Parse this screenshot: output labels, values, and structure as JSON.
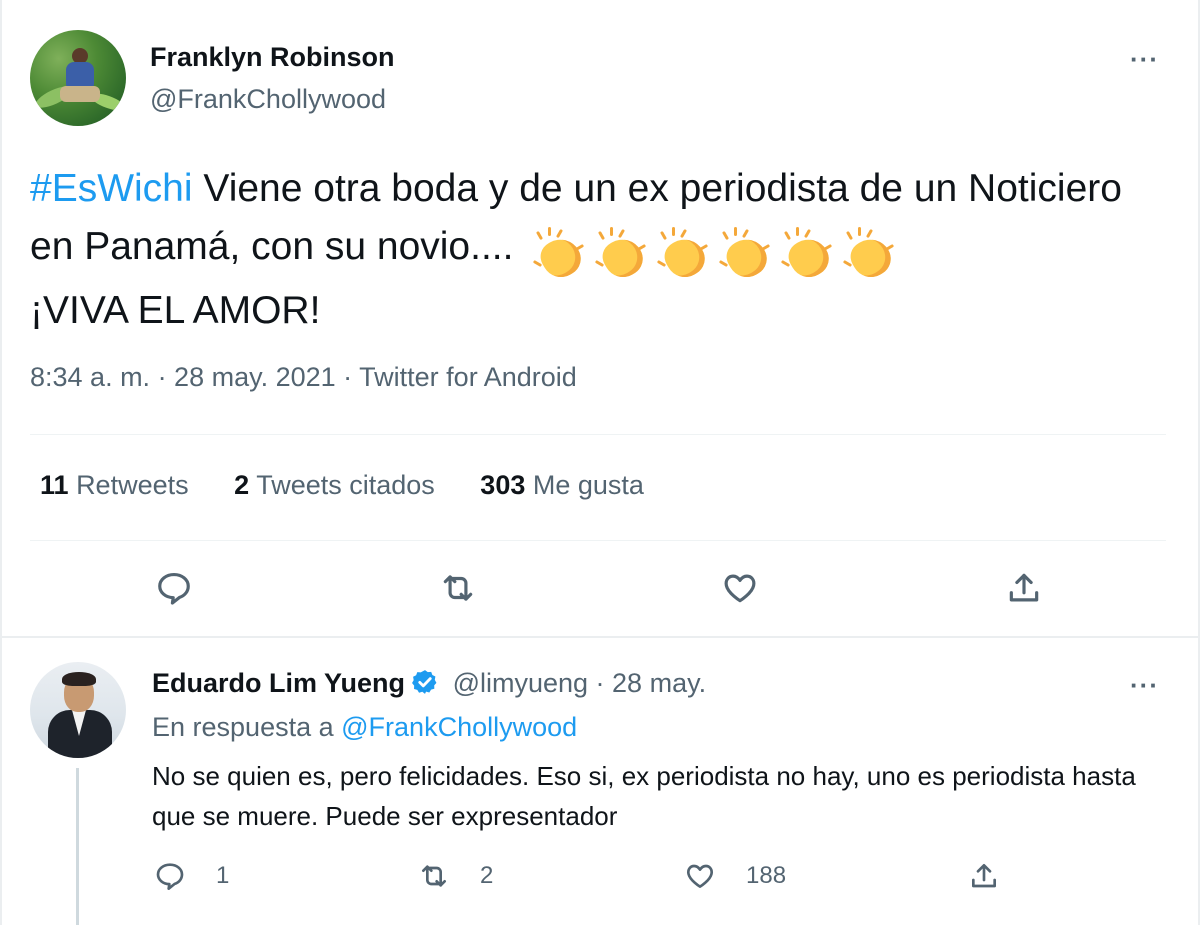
{
  "main_tweet": {
    "author_name": "Franklyn Robinson",
    "author_handle": "@FrankChollywood",
    "more_label": "···",
    "hashtag": "#EsWichi",
    "text_part1": " Viene otra boda y de un ex periodista de un Noticiero en Panamá, con su novio.... ",
    "emoji": "clapping-hands",
    "emoji_count": 6,
    "text_part2": "¡VIVA EL AMOR!",
    "timestamp": "8:34 a. m. · 28 may. 2021 · Twitter for Android",
    "stats": {
      "retweets_count": "11",
      "retweets_label": "Retweets",
      "quotes_count": "2",
      "quotes_label": "Tweets citados",
      "likes_count": "303",
      "likes_label": "Me gusta"
    },
    "actions": [
      "reply-icon",
      "retweet-icon",
      "like-icon",
      "share-icon"
    ]
  },
  "reply_tweet": {
    "author_name": "Eduardo Lim Yueng",
    "verified": true,
    "author_handle": "@limyueng",
    "date": "· 28 may.",
    "more_label": "···",
    "in_reply_prefix": "En respuesta a",
    "in_reply_handle": "@FrankChollywood",
    "text": "No se quien es, pero felicidades. Eso si, ex periodista no hay, uno es periodista hasta que se muere. Puede ser expresentador",
    "reply_count": "1",
    "retweet_count": "2",
    "like_count": "188"
  },
  "colors": {
    "accent": "#1d9bf0",
    "text_primary": "#0f1419",
    "text_secondary": "#536471",
    "divider": "#eff3f4"
  }
}
